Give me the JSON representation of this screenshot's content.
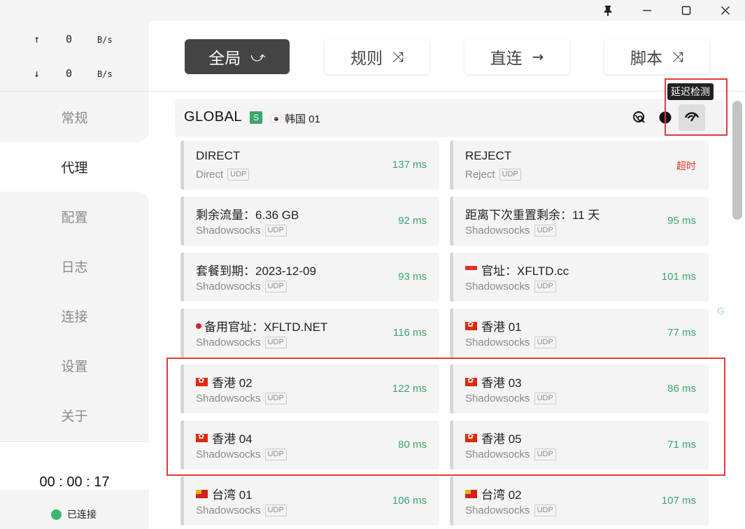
{
  "window": {
    "pin_icon": "pin-icon",
    "min_icon": "minimize-icon",
    "max_icon": "maximize-icon",
    "close_icon": "close-icon"
  },
  "traffic": {
    "up_arrow": "↑",
    "up_value": "0",
    "up_unit": "B/s",
    "down_arrow": "↓",
    "down_value": "0",
    "down_unit": "B/s"
  },
  "nav": {
    "items": [
      "常规",
      "代理",
      "配置",
      "日志",
      "连接",
      "设置",
      "关于"
    ],
    "active_index": 1
  },
  "status": {
    "timer": "00 : 00 : 17",
    "connection": "已连接",
    "connected_color": "#3db76b"
  },
  "modes": [
    {
      "label": "全局",
      "icon": "⤻",
      "active": true
    },
    {
      "label": "规则",
      "icon": "⤨",
      "active": false
    },
    {
      "label": "直连",
      "icon": "→",
      "active": false
    },
    {
      "label": "脚本",
      "icon": "⤨",
      "active": false
    }
  ],
  "group": {
    "name": "GLOBAL",
    "badge": "S",
    "now": "韩国 01",
    "tooltip": "延迟检测"
  },
  "proxies": [
    {
      "name": "DIRECT",
      "type": "Direct",
      "udp": "UDP",
      "delay": "137 ms",
      "flag": "",
      "timeout": false
    },
    {
      "name": "REJECT",
      "type": "Reject",
      "udp": "UDP",
      "delay": "超时",
      "flag": "",
      "timeout": true
    },
    {
      "name": "剩余流量：6.36 GB",
      "type": "Shadowsocks",
      "udp": "UDP",
      "delay": "92 ms",
      "flag": "",
      "timeout": false
    },
    {
      "name": "距离下次重置剩余：11 天",
      "type": "Shadowsocks",
      "udp": "UDP",
      "delay": "95 ms",
      "flag": "",
      "timeout": false
    },
    {
      "name": "套餐到期：2023-12-09",
      "type": "Shadowsocks",
      "udp": "UDP",
      "delay": "93 ms",
      "flag": "",
      "timeout": false
    },
    {
      "name": "官址：XFLTD.cc",
      "type": "Shadowsocks",
      "udp": "UDP",
      "delay": "101 ms",
      "flag": "sg",
      "timeout": false
    },
    {
      "name": "备用官址：XFLTD.NET",
      "type": "Shadowsocks",
      "udp": "UDP",
      "delay": "116 ms",
      "flag": "jp",
      "timeout": false
    },
    {
      "name": "香港 01",
      "type": "Shadowsocks",
      "udp": "UDP",
      "delay": "77 ms",
      "flag": "hk",
      "timeout": false
    },
    {
      "name": "香港 02",
      "type": "Shadowsocks",
      "udp": "UDP",
      "delay": "122 ms",
      "flag": "hk",
      "timeout": false
    },
    {
      "name": "香港 03",
      "type": "Shadowsocks",
      "udp": "UDP",
      "delay": "86 ms",
      "flag": "hk",
      "timeout": false
    },
    {
      "name": "香港 04",
      "type": "Shadowsocks",
      "udp": "UDP",
      "delay": "80 ms",
      "flag": "hk",
      "timeout": false
    },
    {
      "name": "香港 05",
      "type": "Shadowsocks",
      "udp": "UDP",
      "delay": "71 ms",
      "flag": "hk",
      "timeout": false
    },
    {
      "name": "台湾 01",
      "type": "Shadowsocks",
      "udp": "UDP",
      "delay": "106 ms",
      "flag": "tw",
      "timeout": false
    },
    {
      "name": "台湾 02",
      "type": "Shadowsocks",
      "udp": "UDP",
      "delay": "107 ms",
      "flag": "tw",
      "timeout": false
    }
  ],
  "side_letter": "G",
  "colors": {
    "delay_ok": "#3aa76d",
    "delay_timeout": "#d9372b",
    "highlight": "#e03b3b"
  }
}
